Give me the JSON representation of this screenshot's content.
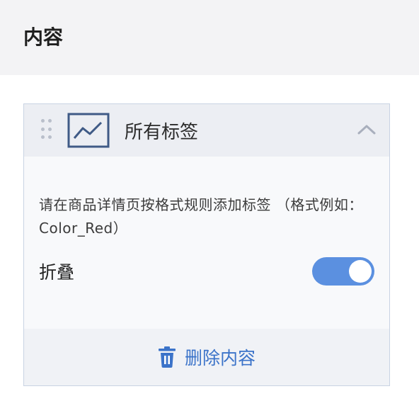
{
  "header": {
    "title": "内容"
  },
  "card": {
    "title": "所有标签",
    "description": "请在商品详情页按格式规则添加标签 （格式例如：Color_Red）",
    "fold_label": "折叠",
    "fold_enabled": true,
    "delete_label": "删除内容"
  },
  "colors": {
    "accent": "#5b90e0",
    "link": "#3b73c9",
    "header_bg": "#f3f3f5",
    "card_border": "#c9d3e3"
  },
  "icons": [
    "drag-handle-icon",
    "image-icon",
    "chevron-up-icon",
    "trash-icon"
  ]
}
